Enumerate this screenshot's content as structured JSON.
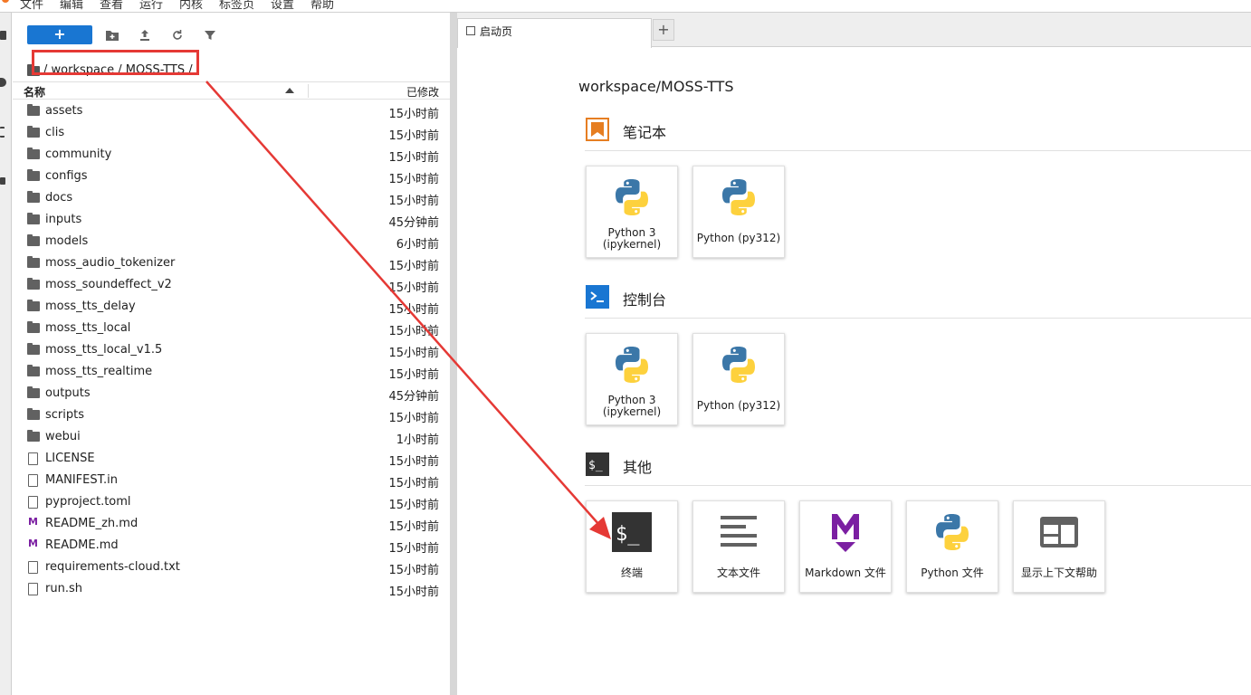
{
  "menubar": {
    "items": [
      "文件",
      "编辑",
      "查看",
      "运行",
      "内核",
      "标签页",
      "设置",
      "帮助"
    ]
  },
  "filebrowser": {
    "new_button_label": "+",
    "toolbar_icons": [
      "new-folder-icon",
      "upload-icon",
      "refresh-icon",
      "filter-icon"
    ],
    "breadcrumb": "/ workspace / MOSS-TTS /",
    "columns": {
      "name": "名称",
      "modified": "已修改"
    },
    "items": [
      {
        "name": "assets",
        "modified": "15小时前",
        "type": "folder"
      },
      {
        "name": "clis",
        "modified": "15小时前",
        "type": "folder"
      },
      {
        "name": "community",
        "modified": "15小时前",
        "type": "folder"
      },
      {
        "name": "configs",
        "modified": "15小时前",
        "type": "folder"
      },
      {
        "name": "docs",
        "modified": "15小时前",
        "type": "folder"
      },
      {
        "name": "inputs",
        "modified": "45分钟前",
        "type": "folder"
      },
      {
        "name": "models",
        "modified": "6小时前",
        "type": "folder"
      },
      {
        "name": "moss_audio_tokenizer",
        "modified": "15小时前",
        "type": "folder"
      },
      {
        "name": "moss_soundeffect_v2",
        "modified": "15小时前",
        "type": "folder"
      },
      {
        "name": "moss_tts_delay",
        "modified": "15小时前",
        "type": "folder"
      },
      {
        "name": "moss_tts_local",
        "modified": "15小时前",
        "type": "folder"
      },
      {
        "name": "moss_tts_local_v1.5",
        "modified": "15小时前",
        "type": "folder"
      },
      {
        "name": "moss_tts_realtime",
        "modified": "15小时前",
        "type": "folder"
      },
      {
        "name": "outputs",
        "modified": "45分钟前",
        "type": "folder"
      },
      {
        "name": "scripts",
        "modified": "15小时前",
        "type": "folder"
      },
      {
        "name": "webui",
        "modified": "1小时前",
        "type": "folder"
      },
      {
        "name": "LICENSE",
        "modified": "15小时前",
        "type": "file"
      },
      {
        "name": "MANIFEST.in",
        "modified": "15小时前",
        "type": "file"
      },
      {
        "name": "pyproject.toml",
        "modified": "15小时前",
        "type": "file"
      },
      {
        "name": "README_zh.md",
        "modified": "15小时前",
        "type": "markdown"
      },
      {
        "name": "README.md",
        "modified": "15小时前",
        "type": "markdown"
      },
      {
        "name": "requirements-cloud.txt",
        "modified": "15小时前",
        "type": "file"
      },
      {
        "name": "run.sh",
        "modified": "15小时前",
        "type": "file"
      }
    ]
  },
  "tabs": [
    {
      "label": "启动页"
    }
  ],
  "tab_add_label": "+",
  "launcher": {
    "path": "workspace/MOSS-TTS",
    "sections": {
      "notebook": {
        "title": "笔记本",
        "cards": [
          "Python 3 (ipykernel)",
          "Python (py312)"
        ]
      },
      "console": {
        "title": "控制台",
        "cards": [
          "Python 3 (ipykernel)",
          "Python (py312)"
        ]
      },
      "other": {
        "title": "其他",
        "cards": [
          "终端",
          "文本文件",
          "Markdown 文件",
          "Python 文件",
          "显示上下文帮助"
        ]
      }
    }
  },
  "colors": {
    "accent": "#1976d2",
    "annotation": "#e53935",
    "markdown": "#7b1fa2",
    "notebook_icon": "#e67e22"
  }
}
